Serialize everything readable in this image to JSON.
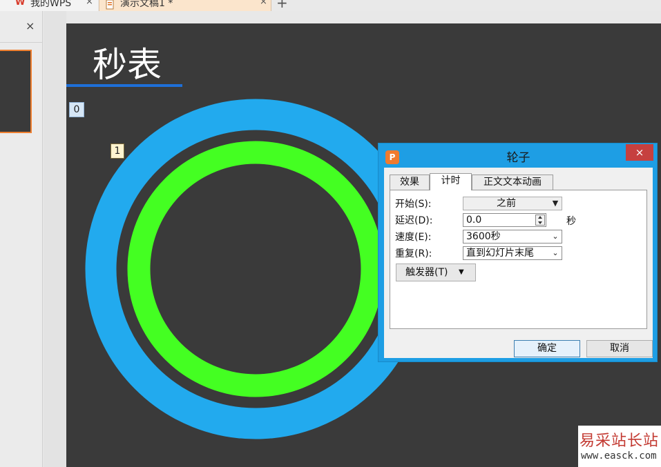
{
  "tabs": [
    {
      "label": "我的WPS",
      "close": "×"
    },
    {
      "label": "演示文稿1 *",
      "close": "×"
    }
  ],
  "new_tab_symbol": "+",
  "left_pane": {
    "close": "×"
  },
  "slide": {
    "title": "秒表",
    "animation_tags": [
      "0",
      "1"
    ],
    "colors": {
      "background": "#3a3a3a",
      "outer_ring": "#22aaee",
      "inner_ring": "#44ff22",
      "title_underline": "#1e6fd8"
    }
  },
  "dialog": {
    "title": "轮子",
    "close": "×",
    "icon": "wps-presentation-icon",
    "tabs": [
      "效果",
      "计时",
      "正文文本动画"
    ],
    "active_tab": "计时",
    "start_label": "开始(S):",
    "start_value": "之前",
    "delay_label": "延迟(D):",
    "delay_value": "0.0",
    "delay_unit": "秒",
    "speed_label": "速度(E):",
    "speed_value": "3600秒",
    "repeat_label": "重复(R):",
    "repeat_value": "直到幻灯片末尾",
    "trigger_label": "触发器(T)",
    "ok_label": "确定",
    "cancel_label": "取消"
  },
  "watermark": {
    "main": "易采站长站",
    "url": "www.easck.com"
  }
}
